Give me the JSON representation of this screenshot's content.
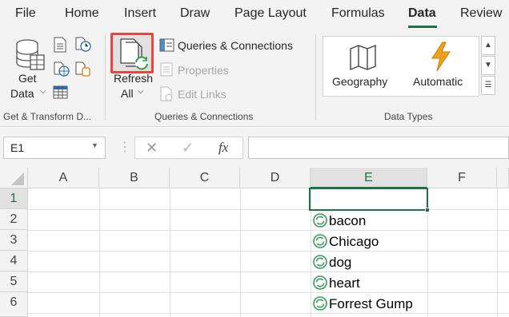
{
  "tabs": [
    "File",
    "Home",
    "Insert",
    "Draw",
    "Page Layout",
    "Formulas",
    "Data",
    "Review"
  ],
  "active_tab": "Data",
  "ribbon": {
    "get_transform": {
      "get_data_line1": "Get",
      "get_data_line2": "Data",
      "group_label": "Get & Transform D..."
    },
    "queries": {
      "refresh_line1": "Refresh",
      "refresh_line2": "All",
      "queries_connections": "Queries & Connections",
      "properties": "Properties",
      "edit_links": "Edit Links",
      "group_label": "Queries & Connections"
    },
    "data_types": {
      "geography": "Geography",
      "automatic": "Automatic",
      "group_label": "Data Types"
    }
  },
  "formula_bar": {
    "name_box": "E1",
    "cancel_symbol": "✕",
    "enter_symbol": "✓",
    "fx_symbol": "fx",
    "formula_value": ""
  },
  "grid": {
    "columns": [
      "A",
      "B",
      "C",
      "D",
      "E",
      "F"
    ],
    "rows": [
      "1",
      "2",
      "3",
      "4",
      "5",
      "6"
    ],
    "selected_cell": "E1",
    "column_e_values": [
      "",
      "bacon",
      "Chicago",
      "dog",
      "heart",
      "Forrest Gump"
    ]
  },
  "colors": {
    "excel_green": "#1e7145",
    "highlight_red": "#e8453c",
    "linked_type_icon": "#3a9b5c",
    "automatic_icon": "#f0a020"
  }
}
